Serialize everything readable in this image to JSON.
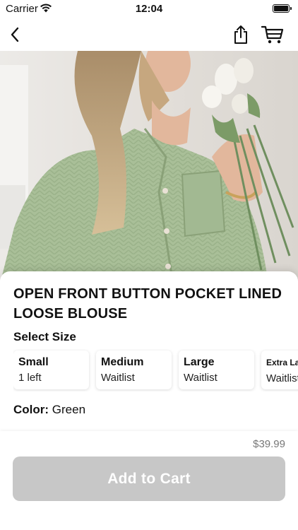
{
  "status_bar": {
    "carrier": "Carrier",
    "time": "12:04"
  },
  "nav": {
    "back_icon": "chevron-left-icon",
    "share_icon": "share-icon",
    "cart_icon": "cart-icon"
  },
  "product": {
    "title": "OPEN FRONT BUTTON POCKET LINED LOOSE BLOUSE",
    "select_size_label": "Select Size",
    "sizes": [
      {
        "name": "Small",
        "availability": "1 left"
      },
      {
        "name": "Medium",
        "availability": "Waitlist"
      },
      {
        "name": "Large",
        "availability": "Waitlist"
      },
      {
        "name": "Extra Large",
        "availability": "Waitlist"
      }
    ],
    "color_label": "Color:",
    "color_value": "Green"
  },
  "footer": {
    "price": "$39.99",
    "add_to_cart": "Add to Cart"
  },
  "colors": {
    "button_disabled": "#c7c7c7",
    "blouse": "#a9bf98"
  }
}
